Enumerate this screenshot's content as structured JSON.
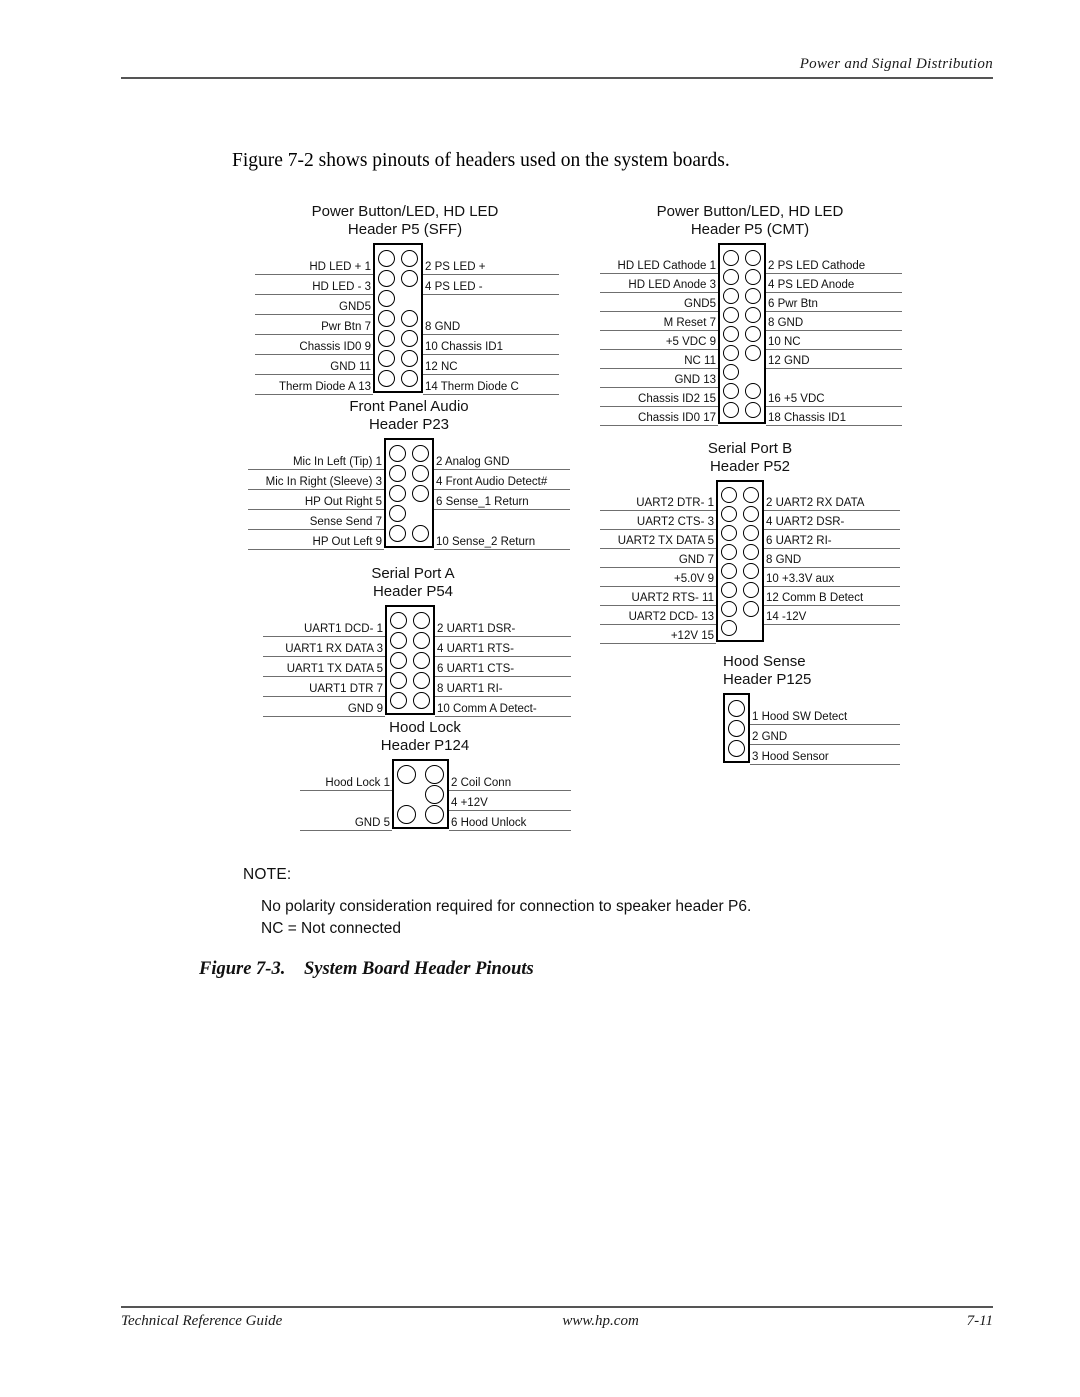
{
  "running_header": {
    "text": "Power and Signal Distribution"
  },
  "intro": {
    "text": "Figure 7-2 shows pinouts of headers used on the system boards."
  },
  "connectors": [
    {
      "id": "p5-sff",
      "title_line1": "Power Button/LED, HD LED",
      "title_line2": "Header P5 (SFF)",
      "rows": [
        {
          "left": "HD LED + 1",
          "right": "2 PS LED +",
          "left_pin": true,
          "right_pin": true
        },
        {
          "left": "HD LED - 3",
          "right": "4 PS LED -",
          "left_pin": true,
          "right_pin": true
        },
        {
          "left": "GND5",
          "right": "",
          "left_pin": true,
          "right_pin": false
        },
        {
          "left": "Pwr Btn 7",
          "right": "8 GND",
          "left_pin": true,
          "right_pin": true
        },
        {
          "left": "Chassis ID0 9",
          "right": "10 Chassis ID1",
          "left_pin": true,
          "right_pin": true
        },
        {
          "left": "GND 11",
          "right": "12 NC",
          "left_pin": true,
          "right_pin": true
        },
        {
          "left": "Therm Diode A 13",
          "right": "14 Therm Diode C",
          "left_pin": true,
          "right_pin": true
        }
      ]
    },
    {
      "id": "p5-cmt",
      "title_line1": "Power Button/LED, HD LED",
      "title_line2": "Header P5 (CMT)",
      "rows": [
        {
          "left": "HD LED Cathode 1",
          "right": "2 PS LED Cathode",
          "left_pin": true,
          "right_pin": true
        },
        {
          "left": "HD LED Anode 3",
          "right": "4 PS LED Anode",
          "left_pin": true,
          "right_pin": true
        },
        {
          "left": "GND5",
          "right": "6 Pwr Btn",
          "left_pin": true,
          "right_pin": true
        },
        {
          "left": "M Reset 7",
          "right": "8 GND",
          "left_pin": true,
          "right_pin": true
        },
        {
          "left": "+5 VDC 9",
          "right": "10 NC",
          "left_pin": true,
          "right_pin": true
        },
        {
          "left": "NC 11",
          "right": "12 GND",
          "left_pin": true,
          "right_pin": true
        },
        {
          "left": "GND 13",
          "right": "",
          "left_pin": true,
          "right_pin": false
        },
        {
          "left": "Chassis ID2 15",
          "right": "16 +5 VDC",
          "left_pin": true,
          "right_pin": true
        },
        {
          "left": "Chassis ID0 17",
          "right": "18 Chassis ID1",
          "left_pin": true,
          "right_pin": true
        }
      ]
    },
    {
      "id": "p23-audio",
      "title_line1": "Front Panel Audio",
      "title_line2": "Header P23",
      "rows": [
        {
          "left": "Mic In Left (Tip) 1",
          "right": "2 Analog GND",
          "left_pin": true,
          "right_pin": true
        },
        {
          "left": "Mic In Right (Sleeve) 3",
          "right": "4 Front Audio Detect#",
          "left_pin": true,
          "right_pin": true
        },
        {
          "left": "HP Out Right 5",
          "right": "6 Sense_1 Return",
          "left_pin": true,
          "right_pin": true
        },
        {
          "left": "Sense Send 7",
          "right": "",
          "left_pin": true,
          "right_pin": false
        },
        {
          "left": "HP Out Left 9",
          "right": "10 Sense_2 Return",
          "left_pin": true,
          "right_pin": true
        }
      ]
    },
    {
      "id": "p52-serial-b",
      "title_line1": "Serial Port B",
      "title_line2": "Header P52",
      "rows": [
        {
          "left": "UART2 DTR- 1",
          "right": "2 UART2 RX DATA",
          "left_pin": true,
          "right_pin": true
        },
        {
          "left": "UART2 CTS- 3",
          "right": "4 UART2 DSR-",
          "left_pin": true,
          "right_pin": true
        },
        {
          "left": "UART2 TX DATA 5",
          "right": "6 UART2 RI-",
          "left_pin": true,
          "right_pin": true
        },
        {
          "left": "GND 7",
          "right": "8 GND",
          "left_pin": true,
          "right_pin": true
        },
        {
          "left": "+5.0V 9",
          "right": "10 +3.3V aux",
          "left_pin": true,
          "right_pin": true
        },
        {
          "left": "UART2 RTS- 11",
          "right": "12 Comm B Detect",
          "left_pin": true,
          "right_pin": true
        },
        {
          "left": "UART2 DCD- 13",
          "right": "14 -12V",
          "left_pin": true,
          "right_pin": true
        },
        {
          "left": "+12V 15",
          "right": "",
          "left_pin": true,
          "right_pin": false
        }
      ]
    },
    {
      "id": "p54-serial-a",
      "title_line1": "Serial Port A",
      "title_line2": "Header P54",
      "rows": [
        {
          "left": "UART1 DCD- 1",
          "right": "2 UART1 DSR-",
          "left_pin": true,
          "right_pin": true
        },
        {
          "left": "UART1 RX DATA 3",
          "right": "4 UART1 RTS-",
          "left_pin": true,
          "right_pin": true
        },
        {
          "left": "UART1 TX DATA 5",
          "right": "6 UART1 CTS-",
          "left_pin": true,
          "right_pin": true
        },
        {
          "left": "UART1 DTR 7",
          "right": "8 UART1 RI-",
          "left_pin": true,
          "right_pin": true
        },
        {
          "left": "GND 9",
          "right": "10 Comm A Detect-",
          "left_pin": true,
          "right_pin": true
        }
      ]
    },
    {
      "id": "p125-hood-sense",
      "title_line1": "Hood Sense",
      "title_line2": "Header P125",
      "rows": [
        {
          "left": "",
          "right": "1 Hood SW Detect",
          "left_pin": true,
          "right_pin": false
        },
        {
          "left": "",
          "right": "2 GND",
          "left_pin": true,
          "right_pin": false
        },
        {
          "left": "",
          "right": "3 Hood Sensor",
          "left_pin": true,
          "right_pin": false
        }
      ]
    },
    {
      "id": "p124-hood-lock",
      "title_line1": "Hood Lock",
      "title_line2": "Header P124",
      "rows": [
        {
          "left": "Hood Lock 1",
          "right": "2 Coil Conn",
          "left_pin": true,
          "right_pin": true
        },
        {
          "left": "",
          "right": "4 +12V",
          "left_pin": false,
          "right_pin": true
        },
        {
          "left": "GND 5",
          "right": "6 Hood Unlock",
          "left_pin": true,
          "right_pin": true
        }
      ]
    }
  ],
  "note": {
    "heading": "NOTE:",
    "line1": "No polarity consideration required for connection to speaker header P6.",
    "line2": "NC = Not connected"
  },
  "caption": {
    "number": "Figure 7-3.",
    "text": "System Board Header Pinouts"
  },
  "footer": {
    "left": "Technical Reference Guide",
    "center": "www.hp.com",
    "right": "7-11"
  }
}
